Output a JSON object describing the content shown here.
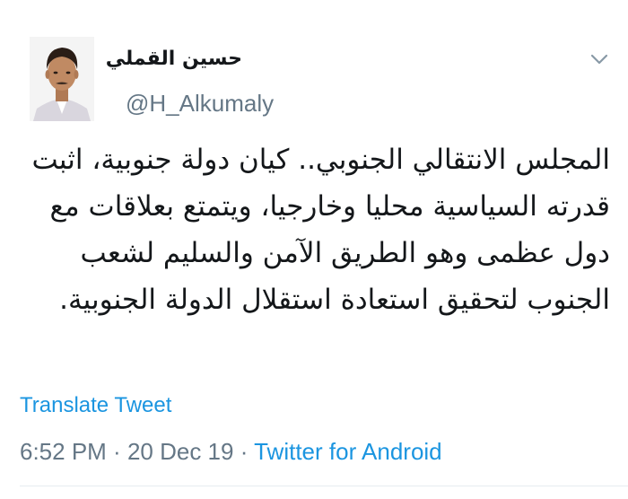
{
  "tweet": {
    "author": {
      "display_name": "حسين القملي",
      "handle": "@H_Alkumaly"
    },
    "text": "المجلس الانتقالي الجنوبي.. كيان دولة جنوبية، اثبت قدرته السياسية محليا وخارجيا، ويتمتع بعلاقات مع دول عظمى وهو الطريق الآمن والسليم لشعب الجنوب لتحقيق استعادة استقلال الدولة الجنوبية.",
    "translate_label": "Translate Tweet",
    "time": "6:52 PM",
    "separator": " · ",
    "date": "20 Dec 19",
    "source": "Twitter for Android"
  },
  "icons": {
    "avatar": "user-photo",
    "menu": "chevron-down-icon"
  },
  "colors": {
    "link": "#1b95e0",
    "secondary_text": "#657786",
    "primary_text": "#14171a"
  }
}
